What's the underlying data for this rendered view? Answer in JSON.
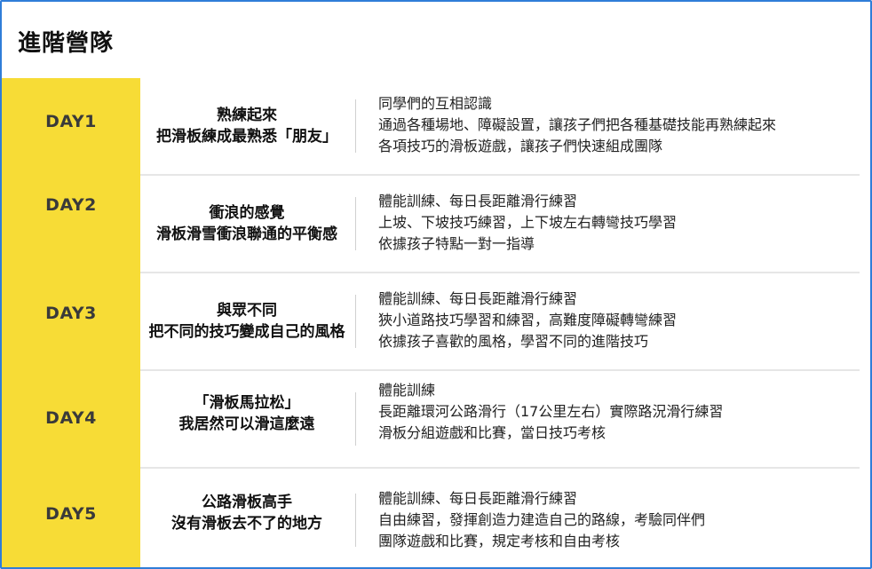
{
  "page": {
    "title": "進階營隊"
  },
  "days": [
    {
      "day": "DAY1",
      "theme": [
        "熟練起來",
        "把滑板練成最熟悉「朋友」"
      ],
      "details": [
        "同學們的互相認識",
        "通過各種場地、障礙設置，讓孩子們把各種基礎技能再熟練起來",
        "各項技巧的滑板遊戲，讓孩子們快速組成團隊"
      ]
    },
    {
      "day": "DAY2",
      "theme": [
        "衝浪的感覺",
        "滑板滑雪衝浪聯通的平衡感"
      ],
      "details": [
        "體能訓練、每日長距離滑行練習",
        "上坡、下坡技巧練習，上下坡左右轉彎技巧學習",
        "依據孩子特點一對一指導"
      ]
    },
    {
      "day": "DAY3",
      "theme": [
        "與眾不同",
        "把不同的技巧變成自己的風格"
      ],
      "details": [
        "體能訓練、每日長距離滑行練習",
        "狹小道路技巧學習和練習，高難度障礙轉彎練習",
        "依據孩子喜歡的風格，學習不同的進階技巧"
      ]
    },
    {
      "day": "DAY4",
      "theme": [
        "「滑板馬拉松」",
        "我居然可以滑這麼遠"
      ],
      "details": [
        "體能訓練",
        "長距離環河公路滑行（17公里左右）實際路況滑行練習",
        "滑板分組遊戲和比賽，當日技巧考核"
      ]
    },
    {
      "day": "DAY5",
      "theme": [
        "公路滑板高手",
        "沒有滑板去不了的地方"
      ],
      "details": [
        "體能訓練、每日長距離滑行練習",
        "自由練習，發揮創造力建造自己的路線，考驗同伴們",
        "團隊遊戲和比賽，規定考核和自由考核"
      ]
    }
  ]
}
